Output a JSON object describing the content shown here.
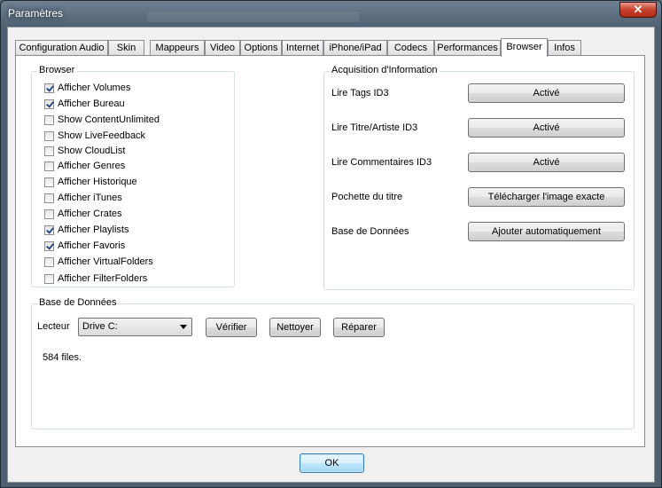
{
  "window": {
    "title": "Paramètres",
    "close_glyph": "✕"
  },
  "tabs": [
    {
      "label": "Configuration Audio"
    },
    {
      "label": "Skin"
    },
    {
      "label": "Mappeurs"
    },
    {
      "label": "Video"
    },
    {
      "label": "Options"
    },
    {
      "label": "Internet"
    },
    {
      "label": "iPhone/iPad"
    },
    {
      "label": "Codecs"
    },
    {
      "label": "Performances"
    },
    {
      "label": "Browser",
      "active": true
    },
    {
      "label": "Infos"
    }
  ],
  "browser_group": {
    "legend": "Browser",
    "items": [
      {
        "label": "Afficher Volumes",
        "checked": true
      },
      {
        "label": "Afficher Bureau",
        "checked": true
      },
      {
        "label": "Show ContentUnlimited",
        "checked": false
      },
      {
        "label": "Show LiveFeedback",
        "checked": false
      },
      {
        "label": "Show CloudList",
        "checked": false
      },
      {
        "label": "Afficher Genres",
        "checked": false
      },
      {
        "label": "Afficher Historique",
        "checked": false
      },
      {
        "label": "Afficher iTunes",
        "checked": false
      },
      {
        "label": "Afficher Crates",
        "checked": false
      },
      {
        "label": "Afficher Playlists",
        "checked": true
      },
      {
        "label": "Afficher Favoris",
        "checked": true
      },
      {
        "label": "Afficher VirtualFolders",
        "checked": false
      },
      {
        "label": "Afficher FilterFolders",
        "checked": false
      }
    ]
  },
  "acquisition_group": {
    "legend": "Acquisition d'Information",
    "rows": [
      {
        "label": "Lire Tags ID3",
        "button": "Activé"
      },
      {
        "label": "Lire Titre/Artiste ID3",
        "button": "Activé"
      },
      {
        "label": "Lire Commentaires ID3",
        "button": "Activé"
      },
      {
        "label": "Pochette du titre",
        "button": "Télécharger l'image exacte"
      },
      {
        "label": "Base de Données",
        "button": "Ajouter automatiquement"
      }
    ]
  },
  "database_group": {
    "legend": "Base de Données",
    "drive_label": "Lecteur",
    "drive_value": "Drive C:",
    "verify_button": "Vérifier",
    "clean_button": "Nettoyer",
    "repair_button": "Réparer",
    "status": "584 files."
  },
  "footer": {
    "ok_button": "OK"
  }
}
